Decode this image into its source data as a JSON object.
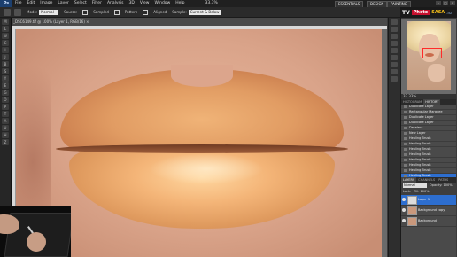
{
  "menubar": {
    "app_logo": "Ps",
    "items": [
      "File",
      "Edit",
      "Image",
      "Layer",
      "Select",
      "Filter",
      "Analysis",
      "3D",
      "View",
      "Window",
      "Help"
    ],
    "zoom": "33.3%",
    "workspaces": [
      "ESSENTIALS",
      "DESIGN",
      "PAINTING"
    ],
    "window_controls": [
      "–",
      "□",
      "×"
    ]
  },
  "options": {
    "mode_label": "Mode:",
    "mode_value": "Normal",
    "source_label": "Source:",
    "source_value": "Sampled",
    "pattern_label": "Pattern",
    "aligned_label": "Aligned",
    "sample_label": "Sample:",
    "sample_value": "Current & Below"
  },
  "tools": [
    "M",
    "L",
    "W",
    "C",
    "I",
    "J",
    "B",
    "S",
    "Y",
    "E",
    "G",
    "O",
    "P",
    "T",
    "A",
    "U",
    "H",
    "Z"
  ],
  "document": {
    "tab_title": "_DSC6149.tif @ 100% (Layer 1, RGB/16) ×"
  },
  "brand": {
    "tv": "TV",
    "photo": "Photo",
    "sasa": "SASA",
    "ru": ".ru"
  },
  "navigator": {
    "zoom": "33.33%",
    "view_box_color": "#ff2a2a"
  },
  "history": {
    "tabs": [
      "HISTOGRAM",
      "HISTORY"
    ],
    "active_tab": "HISTORY",
    "items": [
      "Duplicate Layer",
      "Rectangular Marquee",
      "Duplicate Layer",
      "Duplicate Layer",
      "Deselect",
      "New Layer",
      "Healing Brush",
      "Healing Brush",
      "Healing Brush",
      "Healing Brush",
      "Healing Brush",
      "Healing Brush",
      "Healing Brush",
      "Healing Brush"
    ],
    "selected_index": 13
  },
  "layers": {
    "tabs": [
      "LAYERS",
      "CHANNELS",
      "PATHS"
    ],
    "active_tab": "LAYERS",
    "blend_mode": "Normal",
    "opacity_label": "Opacity:",
    "opacity_value": "100%",
    "lock_label": "Lock:",
    "fill_label": "Fill:",
    "fill_value": "100%",
    "items": [
      "Layer 1",
      "Background copy",
      "Background"
    ],
    "selected_index": 0
  }
}
